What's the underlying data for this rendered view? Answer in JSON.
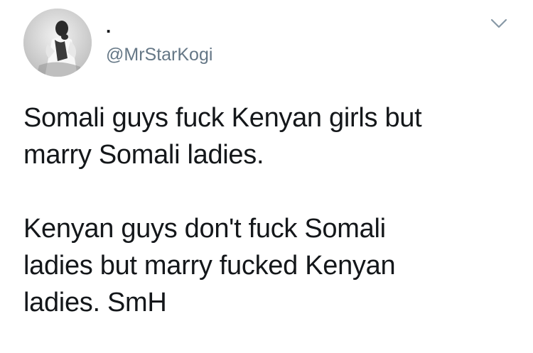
{
  "tweet": {
    "display_name": ".",
    "handle": "@MrStarKogi",
    "paragraphs": [
      {
        "lines": [
          "Somali guys fuck Kenyan girls but",
          "marry Somali ladies."
        ]
      },
      {
        "lines": [
          "Kenyan guys don't fuck Somali",
          "ladies but marry fucked Kenyan",
          "ladies. SmH"
        ]
      }
    ]
  },
  "icons": {
    "menu": "chevron-down-icon",
    "avatar": "profile-photo"
  },
  "colors": {
    "text": "#14171a",
    "secondary": "#657786",
    "background": "#ffffff"
  }
}
